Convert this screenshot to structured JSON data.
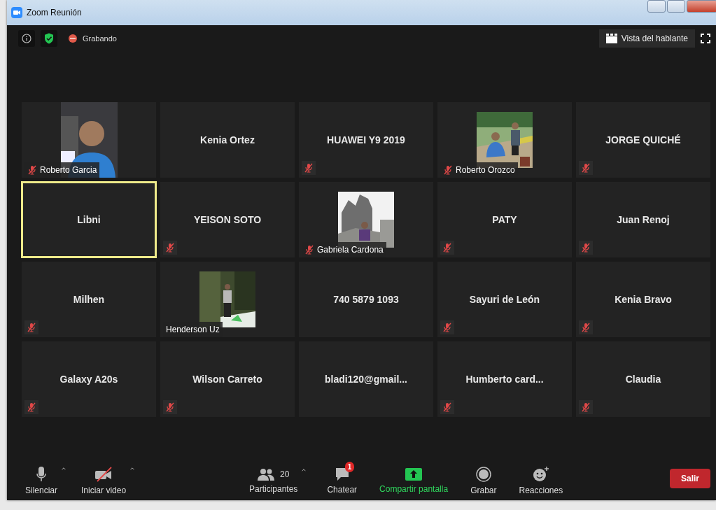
{
  "window": {
    "title": "Zoom Reunión"
  },
  "top_bar": {
    "recording_label": "Grabando",
    "view_button": "Vista del hablante"
  },
  "participants": [
    {
      "name": "Roberto Garcia",
      "video": true,
      "muted": true,
      "speaking": false
    },
    {
      "name": "Kenia Ortez",
      "video": false,
      "muted": false,
      "speaking": false
    },
    {
      "name": "HUAWEI Y9 2019",
      "video": false,
      "muted": true,
      "speaking": false
    },
    {
      "name": "Roberto Orozco",
      "video": true,
      "muted": true,
      "speaking": false
    },
    {
      "name": "JORGE QUICHÉ",
      "video": false,
      "muted": true,
      "speaking": false
    },
    {
      "name": "Libni",
      "video": false,
      "muted": false,
      "speaking": true
    },
    {
      "name": "YEISON SOTO",
      "video": false,
      "muted": true,
      "speaking": false
    },
    {
      "name": "Gabriela Cardona",
      "video": true,
      "muted": true,
      "speaking": false
    },
    {
      "name": "PATY",
      "video": false,
      "muted": true,
      "speaking": false
    },
    {
      "name": "Juan Renoj",
      "video": false,
      "muted": true,
      "speaking": false
    },
    {
      "name": "Milhen",
      "video": false,
      "muted": true,
      "speaking": false
    },
    {
      "name": "Henderson Uz",
      "video": true,
      "muted": false,
      "speaking": false
    },
    {
      "name": "740 5879 1093",
      "video": false,
      "muted": false,
      "speaking": false
    },
    {
      "name": "Sayuri de León",
      "video": false,
      "muted": true,
      "speaking": false
    },
    {
      "name": "Kenia Bravo",
      "video": false,
      "muted": true,
      "speaking": false
    },
    {
      "name": "Galaxy A20s",
      "video": false,
      "muted": true,
      "speaking": false
    },
    {
      "name": "Wilson Carreto",
      "video": false,
      "muted": true,
      "speaking": false
    },
    {
      "name": "bladi120@gmail...",
      "video": false,
      "muted": false,
      "speaking": false
    },
    {
      "name": "Humberto  card...",
      "video": false,
      "muted": true,
      "speaking": false
    },
    {
      "name": "Claudia",
      "video": false,
      "muted": true,
      "speaking": false
    }
  ],
  "toolbar": {
    "items": [
      {
        "kind": "mic",
        "label": "Silenciar",
        "caret": true
      },
      {
        "kind": "video",
        "label": "Iniciar video",
        "caret": true
      },
      {
        "kind": "participants",
        "label": "Participantes",
        "count": "20",
        "caret": true
      },
      {
        "kind": "chat",
        "label": "Chatear",
        "badge": "1"
      },
      {
        "kind": "share",
        "label": "Compartir pantalla"
      },
      {
        "kind": "record",
        "label": "Grabar"
      },
      {
        "kind": "reactions",
        "label": "Reacciones"
      }
    ],
    "leave_button": "Salir"
  }
}
